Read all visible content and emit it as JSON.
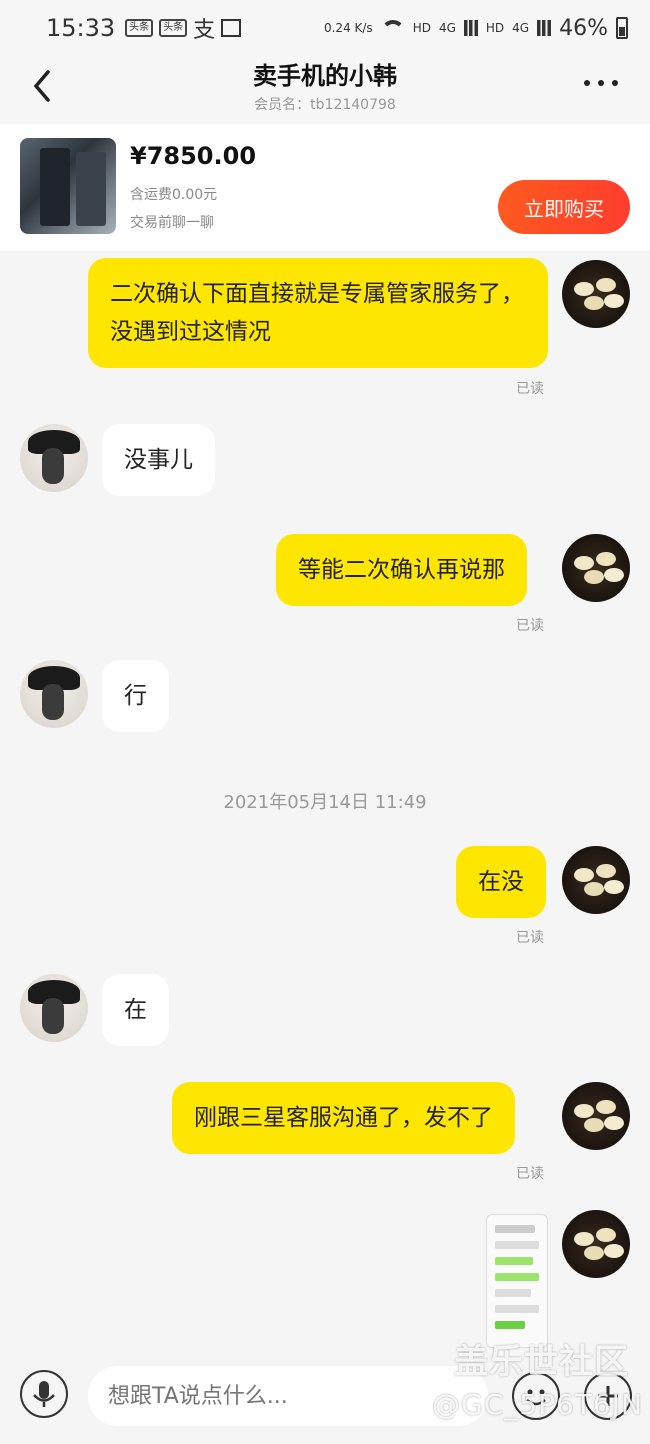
{
  "status_bar": {
    "time": "15:33",
    "icons": [
      "toutiao-icon",
      "toutiao-icon",
      "alipay-icon",
      "gallery-icon"
    ],
    "network_speed": "0.24 K/s",
    "network_labels": [
      "HD",
      "4G",
      "HD",
      "4G"
    ],
    "battery": "46%"
  },
  "header": {
    "title": "卖手机的小韩",
    "member_id": "会员名：tb12140798"
  },
  "product": {
    "price": "¥7850.00",
    "shipping": "含运费0.00元",
    "note": "交易前聊一聊",
    "buy_label": "立即购买"
  },
  "messages": [
    {
      "from": "me",
      "text": "二次确认下面直接就是专属管家服务了，没遇到过这情况",
      "read": "已读"
    },
    {
      "from": "seller",
      "text": "没事儿"
    },
    {
      "from": "me",
      "text": "等能二次确认再说那",
      "read": "已读"
    },
    {
      "from": "seller",
      "text": "行"
    },
    {
      "from": "me",
      "text": "在没",
      "read": "已读"
    },
    {
      "from": "seller",
      "text": "在"
    },
    {
      "from": "me",
      "text": "刚跟三星客服沟通了，发不了",
      "read": "已读"
    }
  ],
  "timestamp": "2021年05月14日 11:49",
  "input": {
    "placeholder": "想跟TA说点什么..."
  },
  "watermark": {
    "site": "盖乐世社区",
    "user": "@GC_5P6T6JN"
  },
  "colors": {
    "my_bubble": "#ffe600",
    "buy_button": "#ff4a28",
    "background": "#f5f5f5"
  }
}
